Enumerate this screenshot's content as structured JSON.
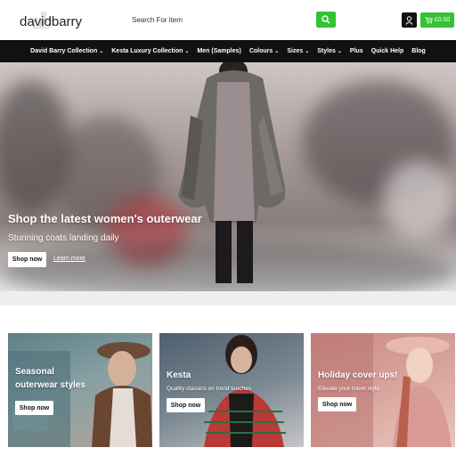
{
  "header": {
    "logo_text": "davidbarry",
    "logo_mark": "db",
    "search_placeholder": "Search For item",
    "cart_total": "£0.00"
  },
  "nav": {
    "items": [
      {
        "label": "David Barry Collection",
        "dropdown": true
      },
      {
        "label": "Kesta Luxury Collection",
        "dropdown": true
      },
      {
        "label": "Men (Samples)",
        "dropdown": false
      },
      {
        "label": "Colours",
        "dropdown": true
      },
      {
        "label": "Sizes",
        "dropdown": true
      },
      {
        "label": "Styles",
        "dropdown": true
      },
      {
        "label": "Plus",
        "dropdown": false
      },
      {
        "label": "Quick Help",
        "dropdown": false
      },
      {
        "label": "Blog",
        "dropdown": false
      }
    ]
  },
  "hero": {
    "title": "Shop the latest women's outerwear",
    "subtitle": "Stunning coats landing daily",
    "shop_label": "Shop now",
    "learn_label": "Learn more"
  },
  "cards": [
    {
      "title_line1": "Seasonal",
      "title_line2": "outerwear styles",
      "subtitle": "",
      "button": "Shop now"
    },
    {
      "title_line1": "Kesta",
      "title_line2": "",
      "subtitle": "Quality classics on trend touches",
      "button": "Shop now"
    },
    {
      "title_line1": "Holiday cover ups!",
      "title_line2": "",
      "subtitle": "Elevate your travel style",
      "button": "Shop now"
    }
  ],
  "colors": {
    "accent_green": "#34c234",
    "nav_bg": "#111111"
  }
}
